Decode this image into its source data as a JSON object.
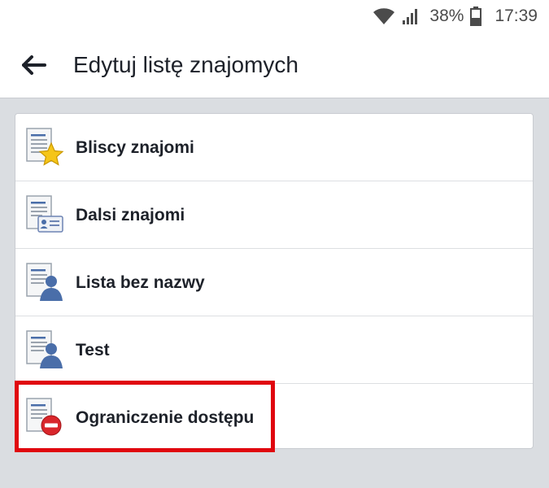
{
  "status_bar": {
    "battery_percent": "38%",
    "time": "17:39",
    "icons": [
      "wifi-icon",
      "signal-icon",
      "battery-icon"
    ]
  },
  "app_bar": {
    "back_icon": "arrow-left-icon",
    "title": "Edytuj listę znajomych"
  },
  "lists": [
    {
      "label": "Bliscy znajomi",
      "icon": "list-star-icon"
    },
    {
      "label": "Dalsi znajomi",
      "icon": "list-id-card-icon"
    },
    {
      "label": "Lista bez nazwy",
      "icon": "list-person-icon"
    },
    {
      "label": "Test",
      "icon": "list-person-icon"
    },
    {
      "label": "Ograniczenie dostępu",
      "icon": "list-restricted-icon"
    }
  ],
  "highlighted_item": "Ograniczenie dostępu",
  "colors": {
    "highlight": "#e0070f",
    "background": "#dadde1",
    "text": "#1d2129",
    "icon_blue": "#4a6ea9",
    "star": "#f5c518",
    "restricted": "#d9262b"
  }
}
